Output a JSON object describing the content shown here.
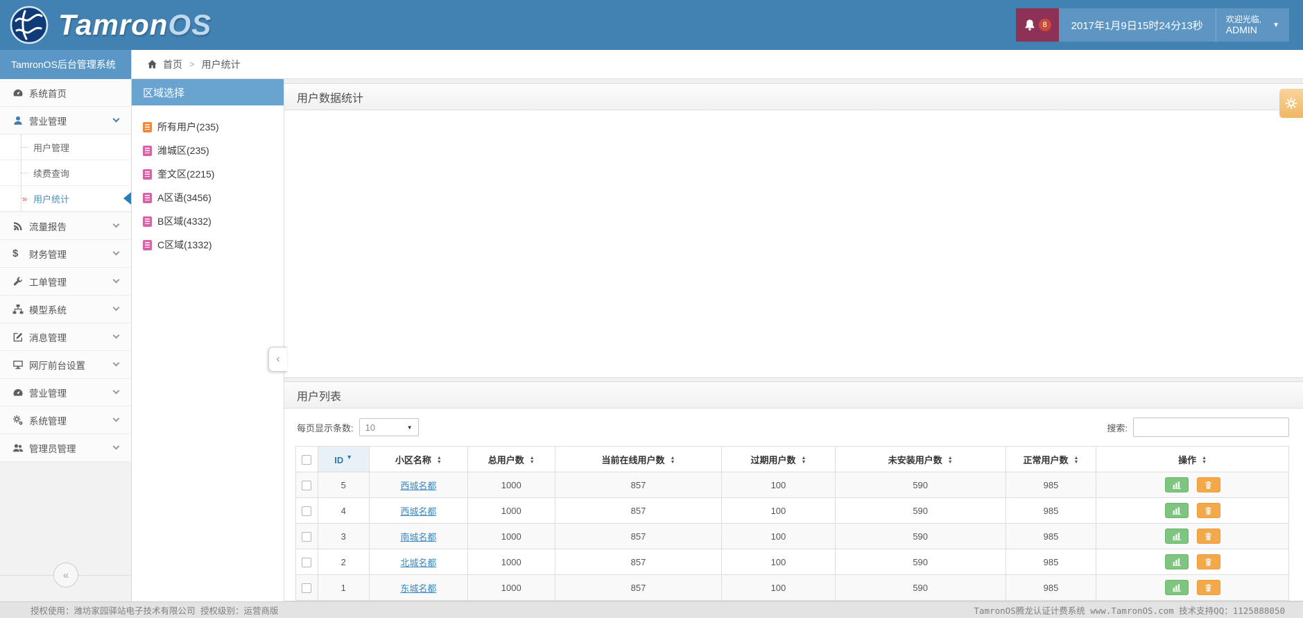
{
  "topbar": {
    "brand_primary": "Tamron",
    "brand_secondary": "OS",
    "notification_count": "8",
    "datetime": "2017年1月9日15时24分13秒",
    "welcome_line1": "欢迎光临,",
    "welcome_line2": "ADMIN"
  },
  "sidebar": {
    "title": "TamronOS后台管理系统",
    "items": [
      {
        "label": "系统首页"
      },
      {
        "label": "营业管理"
      },
      {
        "label": "流量报告"
      },
      {
        "label": "财务管理"
      },
      {
        "label": "工单管理"
      },
      {
        "label": "模型系统"
      },
      {
        "label": "消息管理"
      },
      {
        "label": "网厅前台设置"
      },
      {
        "label": "营业管理"
      },
      {
        "label": "系统管理"
      },
      {
        "label": "管理员管理"
      }
    ],
    "submenu": [
      {
        "label": "用户管理"
      },
      {
        "label": "续费查询"
      },
      {
        "label": "用户统计",
        "active": true
      }
    ]
  },
  "breadcrumb": {
    "home": "首页",
    "separator": ">",
    "current": "用户统计"
  },
  "region_panel": {
    "title": "区域选择",
    "items": [
      {
        "label": "所有用户(235)"
      },
      {
        "label": "潍城区(235)"
      },
      {
        "label": "奎文区(2215)"
      },
      {
        "label": "A区语(3456)"
      },
      {
        "label": "B区域(4332)"
      },
      {
        "label": "C区域(1332)"
      }
    ]
  },
  "stats_panel": {
    "title": "用户数据统计"
  },
  "list_panel": {
    "title": "用户列表",
    "page_size_label": "每页显示条数:",
    "page_size_value": "10",
    "search_label": "搜索:"
  },
  "table": {
    "columns": [
      "ID",
      "小区名称",
      "总用户数",
      "当前在线用户数",
      "过期用户数",
      "未安装用户数",
      "正常用户数",
      "操作"
    ],
    "rows": [
      {
        "id": "5",
        "name": "西城名都",
        "total": "1000",
        "online": "857",
        "expired": "100",
        "uninstalled": "590",
        "normal": "985"
      },
      {
        "id": "4",
        "name": "西城名都",
        "total": "1000",
        "online": "857",
        "expired": "100",
        "uninstalled": "590",
        "normal": "985"
      },
      {
        "id": "3",
        "name": "南城名都",
        "total": "1000",
        "online": "857",
        "expired": "100",
        "uninstalled": "590",
        "normal": "985"
      },
      {
        "id": "2",
        "name": "北城名都",
        "total": "1000",
        "online": "857",
        "expired": "100",
        "uninstalled": "590",
        "normal": "985"
      },
      {
        "id": "1",
        "name": "东城名都",
        "total": "1000",
        "online": "857",
        "expired": "100",
        "uninstalled": "590",
        "normal": "985"
      }
    ]
  },
  "footer": {
    "left": "授权使用：潍坊家园驿站电子技术有限公司  授权级别：运营商版",
    "right": "TamronOS腾龙认证计费系统 www.TamronOS.com 技术支持QQ：1125888050"
  },
  "icons": {
    "dollar": "$",
    "caret_down": "▼",
    "sort_asc": "▲",
    "sort_desc": "▼",
    "id_sort": "▼",
    "active_marker": "»",
    "collapse_left": "‹",
    "collapse_double_left": "«"
  },
  "colors": {
    "topbar": "#4282b2",
    "notification_bg": "#8e3157",
    "badge": "#cc4a35",
    "sidebar_title_bg": "#5b97c6",
    "region_header_bg": "#69a4d0",
    "region_icon_orange": "#f0883d",
    "region_icon_pink": "#d762a8",
    "accent_blue": "#3e84b8",
    "button_green": "#7ec57f",
    "button_orange": "#f3a94a"
  }
}
